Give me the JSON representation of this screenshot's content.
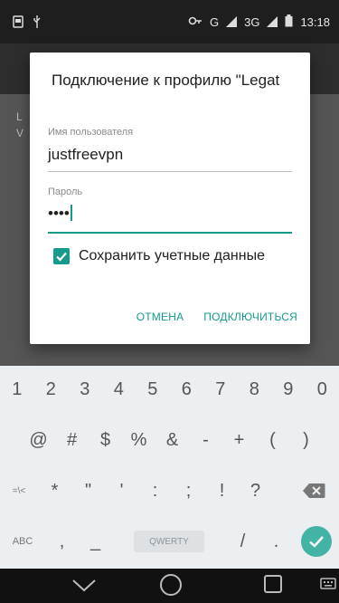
{
  "status_bar": {
    "network_label": "G",
    "network_label_2": "3G",
    "time": "13:18"
  },
  "background_app": {
    "ghost_line_1": "L",
    "ghost_line_2": "V"
  },
  "dialog": {
    "title": "Подключение к профилю \"Legat",
    "username_label": "Имя пользователя",
    "username_value": "justfreevpn",
    "password_label": "Пароль",
    "password_value": "••••",
    "save_credentials_label": "Сохранить учетные данные",
    "save_credentials_checked": true,
    "cancel_label": "ОТМЕНА",
    "connect_label": "ПОДКЛЮЧИТЬСЯ"
  },
  "keyboard": {
    "row1": [
      "1",
      "2",
      "3",
      "4",
      "5",
      "6",
      "7",
      "8",
      "9",
      "0"
    ],
    "row2": [
      "@",
      "#",
      "$",
      "%",
      "&",
      "-",
      "+",
      "(",
      ")"
    ],
    "row3": [
      "=\\<",
      "*",
      "\"",
      "'",
      ":",
      ";",
      "!",
      "?"
    ],
    "row4": {
      "abc": "ABC",
      "comma": ",",
      "underscore": "_",
      "space_label": "QWERTY",
      "slash": "/",
      "period": "."
    }
  },
  "colors": {
    "accent": "#159a8c",
    "enter": "#43b3a6"
  },
  "icons": {
    "status_left": [
      "screenshot-icon",
      "usb-icon"
    ],
    "status_right": [
      "vpn-key-icon",
      "signal-icon",
      "battery-icon"
    ],
    "backspace": "backspace-icon",
    "enter": "enter-check-icon",
    "nav": [
      "back-icon",
      "home-icon",
      "recents-icon",
      "keyboard-switch-icon"
    ]
  }
}
